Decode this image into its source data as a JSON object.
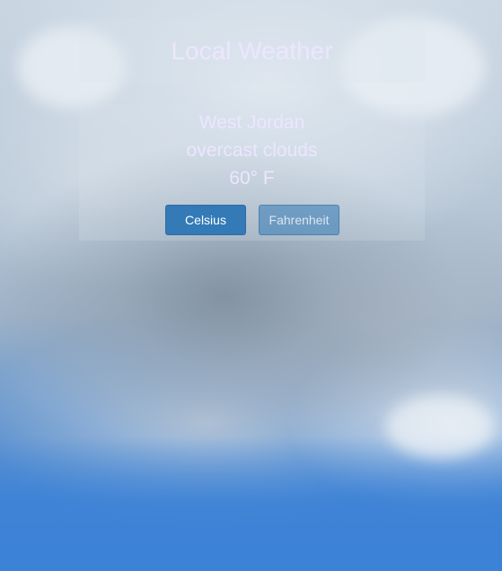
{
  "header": {
    "title": "Local Weather"
  },
  "weather": {
    "location": "West Jordan",
    "description": "overcast clouds",
    "temperature": "60° F"
  },
  "units": {
    "celsius_label": "Celsius",
    "fahrenheit_label": "Fahrenheit",
    "active": "Celsius"
  },
  "colors": {
    "button_primary": "#337ab7",
    "text": "#ece6ff"
  }
}
